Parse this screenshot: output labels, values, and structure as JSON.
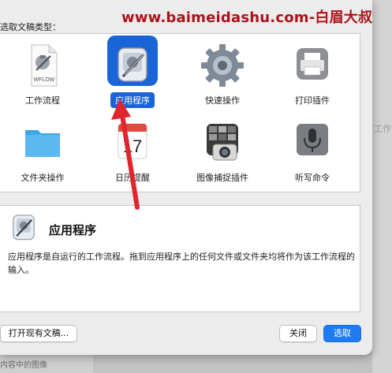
{
  "dialog": {
    "prompt": "选取文稿类型：",
    "watermark": "www.baimeidashu.com-白眉大叔"
  },
  "templates": [
    {
      "label": "工作流程",
      "icon": "workflow-document-icon",
      "icon_text": "WFLOW",
      "selected": false
    },
    {
      "label": "应用程序",
      "icon": "automator-robot-icon",
      "selected": true
    },
    {
      "label": "快速操作",
      "icon": "gear-icon",
      "selected": false
    },
    {
      "label": "打印插件",
      "icon": "printer-icon",
      "selected": false
    },
    {
      "label": "文件夹操作",
      "icon": "folder-icon",
      "selected": false
    },
    {
      "label": "日历提醒",
      "icon": "calendar-icon",
      "icon_text": "17",
      "selected": false
    },
    {
      "label": "图像捕捉插件",
      "icon": "camera-icon",
      "selected": false
    },
    {
      "label": "听写命令",
      "icon": "microphone-icon",
      "selected": false
    }
  ],
  "description": {
    "title": "应用程序",
    "text": "应用程序是自运行的工作流程。拖到应用程序上的任何文件或文件夹均将作为该工作流程的输入。"
  },
  "buttons": {
    "open_existing": "打开现有文稿...",
    "close": "关闭",
    "choose": "选取"
  },
  "background": {
    "right_text": "工作流",
    "bottom_text": "内容中的图像"
  },
  "colors": {
    "selection": "#1a64d8",
    "primary_button": "#1f7bf0",
    "annotation_arrow": "#e0252e"
  }
}
